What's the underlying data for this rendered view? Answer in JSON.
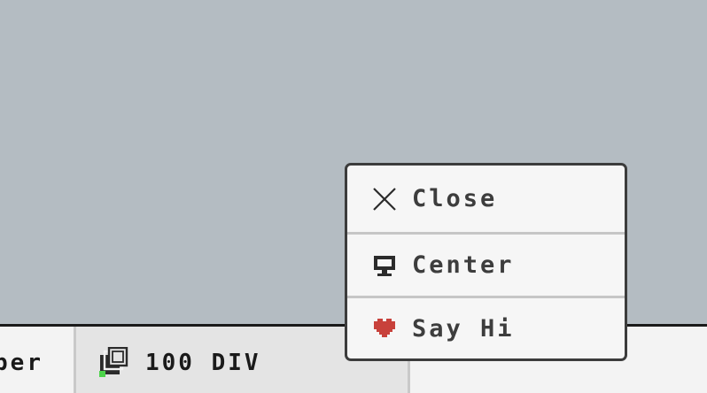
{
  "taskbar": {
    "partial_label": "per",
    "active_label": "100 DIV",
    "active_icon": "overlapping-squares-app-icon"
  },
  "context_menu": {
    "items": [
      {
        "label": "Close",
        "icon": "close-icon"
      },
      {
        "label": "Center",
        "icon": "monitor-icon"
      },
      {
        "label": "Say Hi",
        "icon": "heart-icon",
        "icon_color": "#c8413b"
      }
    ]
  },
  "colors": {
    "desktop": "#b4bcc2",
    "taskbar": "#f3f3f3",
    "active_task": "#e4e4e4",
    "menu_bg": "#f6f6f6",
    "menu_border": "#3c3c3c",
    "heart": "#c8413b"
  }
}
